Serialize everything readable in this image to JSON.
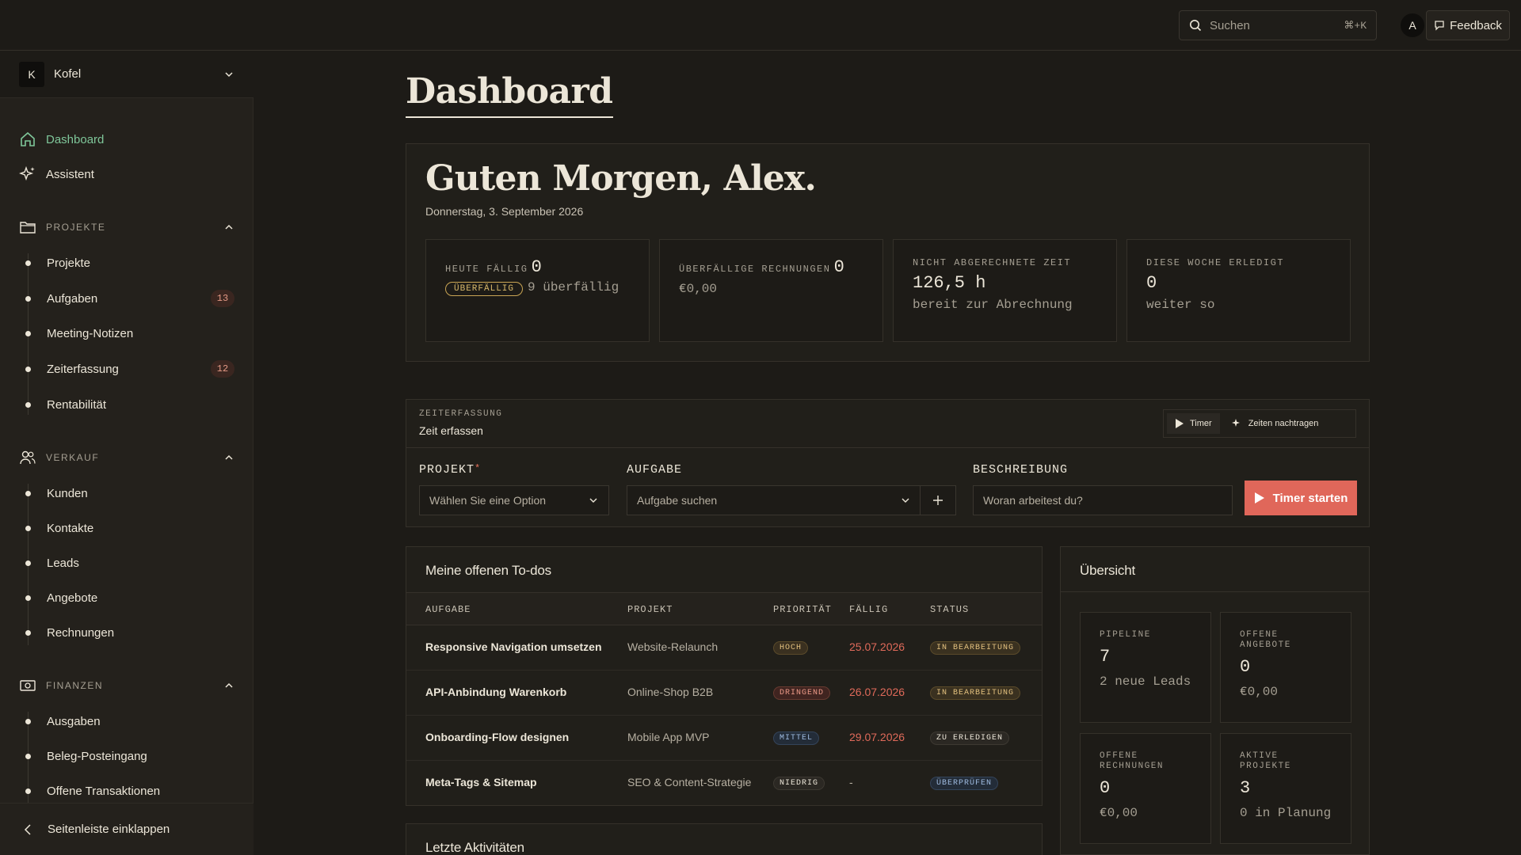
{
  "topbar": {
    "search_placeholder": "Suchen",
    "search_shortcut": "⌘+K",
    "avatar_initial": "A",
    "feedback_label": "Feedback"
  },
  "sidebar": {
    "org_initial": "K",
    "org_name": "Kofel",
    "nav": [
      {
        "label": "Dashboard",
        "icon": "home-icon",
        "active": true
      },
      {
        "label": "Assistent",
        "icon": "sparkles-icon",
        "active": false
      }
    ],
    "sections": [
      {
        "title": "PROJEKTE",
        "icon": "folder-icon",
        "items": [
          {
            "label": "Projekte",
            "badge": ""
          },
          {
            "label": "Aufgaben",
            "badge": "13"
          },
          {
            "label": "Meeting-Notizen",
            "badge": ""
          },
          {
            "label": "Zeiterfassung",
            "badge": "12"
          },
          {
            "label": "Rentabilität",
            "badge": ""
          }
        ]
      },
      {
        "title": "VERKAUF",
        "icon": "users-icon",
        "items": [
          {
            "label": "Kunden"
          },
          {
            "label": "Kontakte"
          },
          {
            "label": "Leads"
          },
          {
            "label": "Angebote"
          },
          {
            "label": "Rechnungen"
          }
        ]
      },
      {
        "title": "FINANZEN",
        "icon": "money-icon",
        "items": [
          {
            "label": "Ausgaben"
          },
          {
            "label": "Beleg-Posteingang"
          },
          {
            "label": "Offene Transaktionen"
          }
        ]
      }
    ],
    "collapse_label": "Seitenleiste einklappen"
  },
  "main": {
    "page_title": "Dashboard",
    "greeting": "Guten Morgen, Alex.",
    "date": "Donnerstag, 3. September 2026",
    "stats": [
      {
        "label": "HEUTE FÄLLIG",
        "value": "0",
        "pill": "ÜBERFÄLLIG",
        "sub": "9 überfällig"
      },
      {
        "label": "ÜBERFÄLLIGE RECHNUNGEN",
        "value": "0",
        "sub": "€0,00"
      },
      {
        "label": "NICHT ABGERECHNETE ZEIT",
        "value": "126,5 h",
        "sub": "bereit zur Abrechnung"
      },
      {
        "label": "DIESE WOCHE ERLEDIGT",
        "value": "0",
        "sub": "weiter so"
      }
    ]
  },
  "time_tracking": {
    "kicker": "ZEITERFASSUNG",
    "title": "Zeit erfassen",
    "mode_timer": "Timer",
    "mode_backfill": "Zeiten nachtragen",
    "project_label": "PROJEKT",
    "project_required": "*",
    "project_placeholder": "Wählen Sie eine Option",
    "task_label": "AUFGABE",
    "task_placeholder": "Aufgabe suchen",
    "desc_label": "BESCHREIBUNG",
    "desc_placeholder": "Woran arbeitest du?",
    "start_label": "Timer starten",
    "accent": "#e0675a"
  },
  "todos": {
    "title": "Meine offenen To-dos",
    "columns": [
      "AUFGABE",
      "PROJEKT",
      "PRIORITÄT",
      "FÄLLIG",
      "STATUS"
    ],
    "rows": [
      {
        "task": "Responsive Navigation umsetzen",
        "project": "Website-Relaunch",
        "priority": "HOCH",
        "due": "25.07.2026",
        "status": "IN BEARBEITUNG"
      },
      {
        "task": "API-Anbindung Warenkorb",
        "project": "Online-Shop B2B",
        "priority": "DRINGEND",
        "due": "26.07.2026",
        "status": "IN BEARBEITUNG"
      },
      {
        "task": "Onboarding-Flow designen",
        "project": "Mobile App MVP",
        "priority": "MITTEL",
        "due": "29.07.2026",
        "status": "ZU ERLEDIGEN"
      },
      {
        "task": "Meta-Tags & Sitemap",
        "project": "SEO & Content-Strategie",
        "priority": "NIEDRIG",
        "due": "-",
        "status": "ÜBERPRÜFEN"
      }
    ]
  },
  "activity": {
    "title": "Letzte Aktivitäten"
  },
  "overview": {
    "title": "Übersicht",
    "tiles": [
      {
        "label": "PIPELINE",
        "value": "7",
        "sub": "2 neue Leads"
      },
      {
        "label": "OFFENE ANGEBOTE",
        "value": "0",
        "sub": "€0,00"
      },
      {
        "label": "OFFENE RECHNUNGEN",
        "value": "0",
        "sub": "€0,00"
      },
      {
        "label": "AKTIVE PROJEKTE",
        "value": "3",
        "sub": "0 in Planung"
      }
    ]
  }
}
